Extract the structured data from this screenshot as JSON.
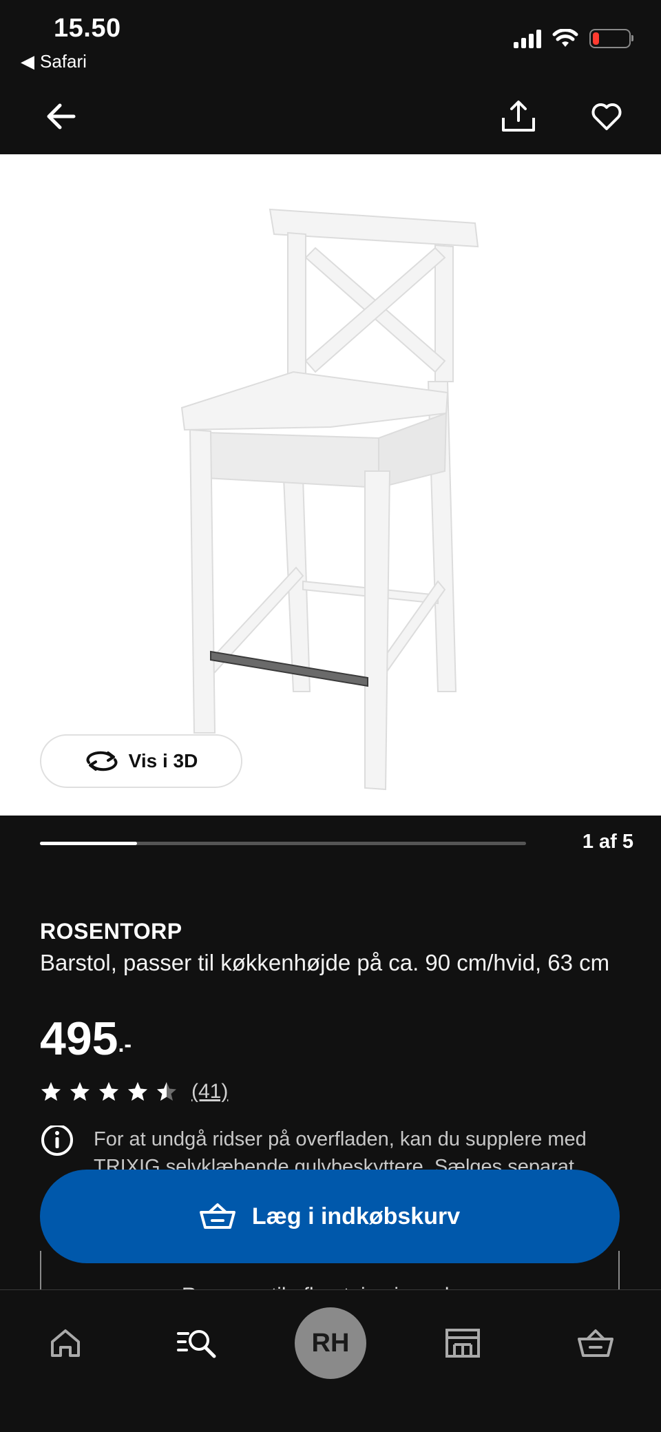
{
  "status_bar": {
    "time": "15.50",
    "back_app": "Safari"
  },
  "gallery": {
    "view_3d_label": "Vis i 3D",
    "counter": "1 af 5",
    "progress_fraction": 0.2
  },
  "product": {
    "name": "ROSENTORP",
    "description": "Barstol, passer til køkkenhøjde på ca. 90 cm/hvid, 63 cm",
    "price": "495",
    "price_suffix": ".-",
    "rating": 4.5,
    "review_count": "(41)",
    "info_text": "For at undgå ridser på overfladen, kan du supplere med TRIXIG selvklæbende gulvbeskyttere. Sælges separat."
  },
  "actions": {
    "add_to_cart_label": "Læg i indkøbskurv",
    "store_label": "Reserver til afhentning i varehus"
  },
  "tab_bar": {
    "avatar_initials": "RH"
  },
  "colors": {
    "background": "#111111",
    "accent": "#0058ab",
    "surface": "#ffffff"
  }
}
